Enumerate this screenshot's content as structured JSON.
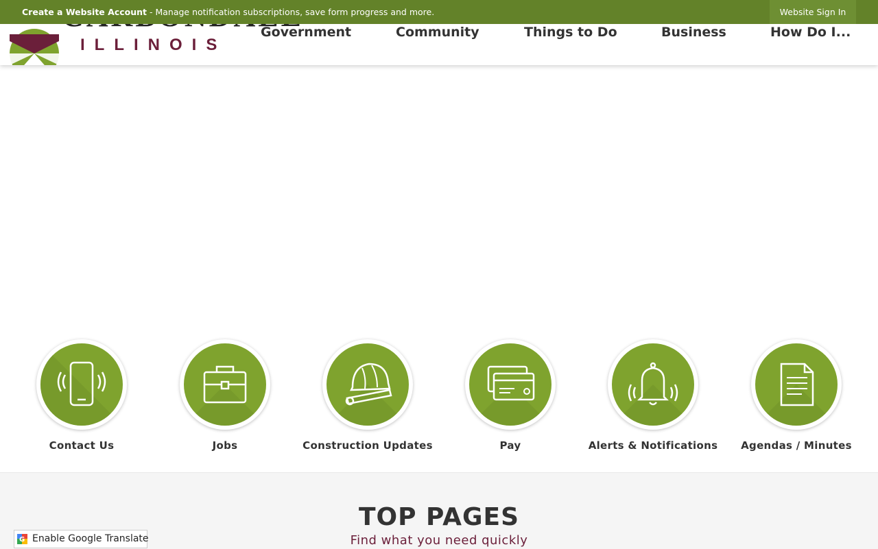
{
  "topbar": {
    "account_link": "Create a Website Account",
    "message": " - Manage notification subscriptions, save form progress and more.",
    "signin": "Website Sign In"
  },
  "logo": {
    "word": "CARBONDALE",
    "sub": "ILLINOIS"
  },
  "nav": [
    {
      "label": "Government"
    },
    {
      "label": "Community"
    },
    {
      "label": "Things to Do"
    },
    {
      "label": "Business"
    },
    {
      "label": "How Do I..."
    }
  ],
  "quick_links": [
    {
      "label": "Contact Us",
      "icon": "phone-icon"
    },
    {
      "label": "Jobs",
      "icon": "briefcase-icon"
    },
    {
      "label": "Construction Updates",
      "icon": "hard-hat-icon"
    },
    {
      "label": "Pay",
      "icon": "credit-card-icon"
    },
    {
      "label": "Alerts & Notifications",
      "icon": "bell-icon"
    },
    {
      "label": "Agendas / Minutes",
      "icon": "document-icon"
    }
  ],
  "top_pages": {
    "title": "TOP PAGES",
    "subtitle": "Find what you need quickly"
  },
  "translate": {
    "label": "Enable Google Translate"
  },
  "colors": {
    "brand_green": "#638229",
    "icon_green": "#7fa32e",
    "maroon": "#6b1f3a"
  }
}
